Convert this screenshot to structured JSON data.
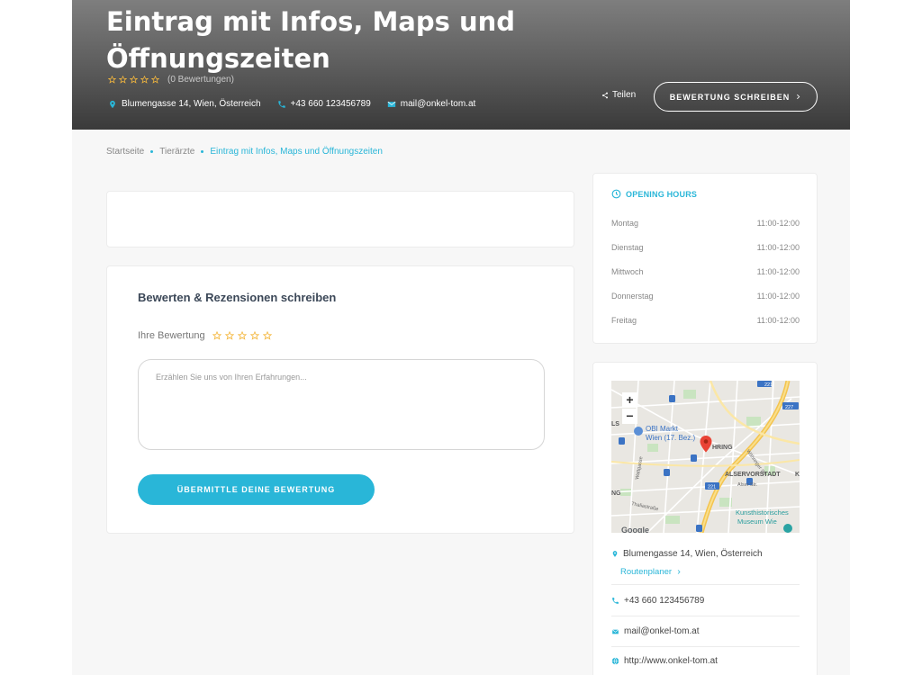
{
  "colors": {
    "accent": "#29b6d8",
    "star": "#f4b73d"
  },
  "hero": {
    "title": "Eintrag mit Infos, Maps und Öffnungszeiten",
    "rating_count": "(0 Bewertungen)",
    "address": "Blumengasse 14, Wien, Österreich",
    "phone": "+43 660 123456789",
    "email": "mail@onkel-tom.at",
    "share_label": "Teilen",
    "review_button": "BEWERTUNG SCHREIBEN",
    "icons": [
      "map-pin-icon",
      "phone-icon",
      "envelope-icon",
      "share-icon",
      "chevron-right-icon"
    ]
  },
  "breadcrumb": [
    "Startseite",
    "Tierärzte",
    "Eintrag mit Infos, Maps und Öffnungszeiten"
  ],
  "review": {
    "title": "Bewerten & Rezensionen schreiben",
    "rating_label": "Ihre Bewertung",
    "textarea_placeholder": "Erzählen Sie uns von Ihren Erfahrungen...",
    "submit_label": "ÜBERMITTLE DEINE BEWERTUNG"
  },
  "hours": {
    "title": "OPENING HOURS",
    "days": [
      {
        "day": "Montag",
        "time": "11:00-12:00"
      },
      {
        "day": "Dienstag",
        "time": "11:00-12:00"
      },
      {
        "day": "Mittwoch",
        "time": "11:00-12:00"
      },
      {
        "day": "Donnerstag",
        "time": "11:00-12:00"
      },
      {
        "day": "Freitag",
        "time": "11:00-12:00"
      }
    ]
  },
  "map": {
    "zoom_in": "+",
    "zoom_out": "−",
    "labels": {
      "obi": "OBI Markt",
      "obi2": "Wien (17. Bez.)",
      "hring": "HRING",
      "alservorstadt": "ALSERVORSTADT",
      "k": "K",
      "ls": "LS",
      "ng": "NG",
      "alser": "Alser Str.",
      "thalia": "Thaliastraße",
      "watt": "Wattgasse",
      "waehr": "Währinger Str.",
      "khm1": "Kunsthistorisches",
      "khm2": "Museum Wie",
      "google": "Google",
      "r221a": "221",
      "r221b": "221",
      "r227": "227"
    }
  },
  "sidebar": {
    "address": "Blumengasse 14, Wien, Österreich",
    "route_label": "Routenplaner",
    "phone": "+43 660 123456789",
    "email": "mail@onkel-tom.at",
    "website": "http://www.onkel-tom.at"
  }
}
